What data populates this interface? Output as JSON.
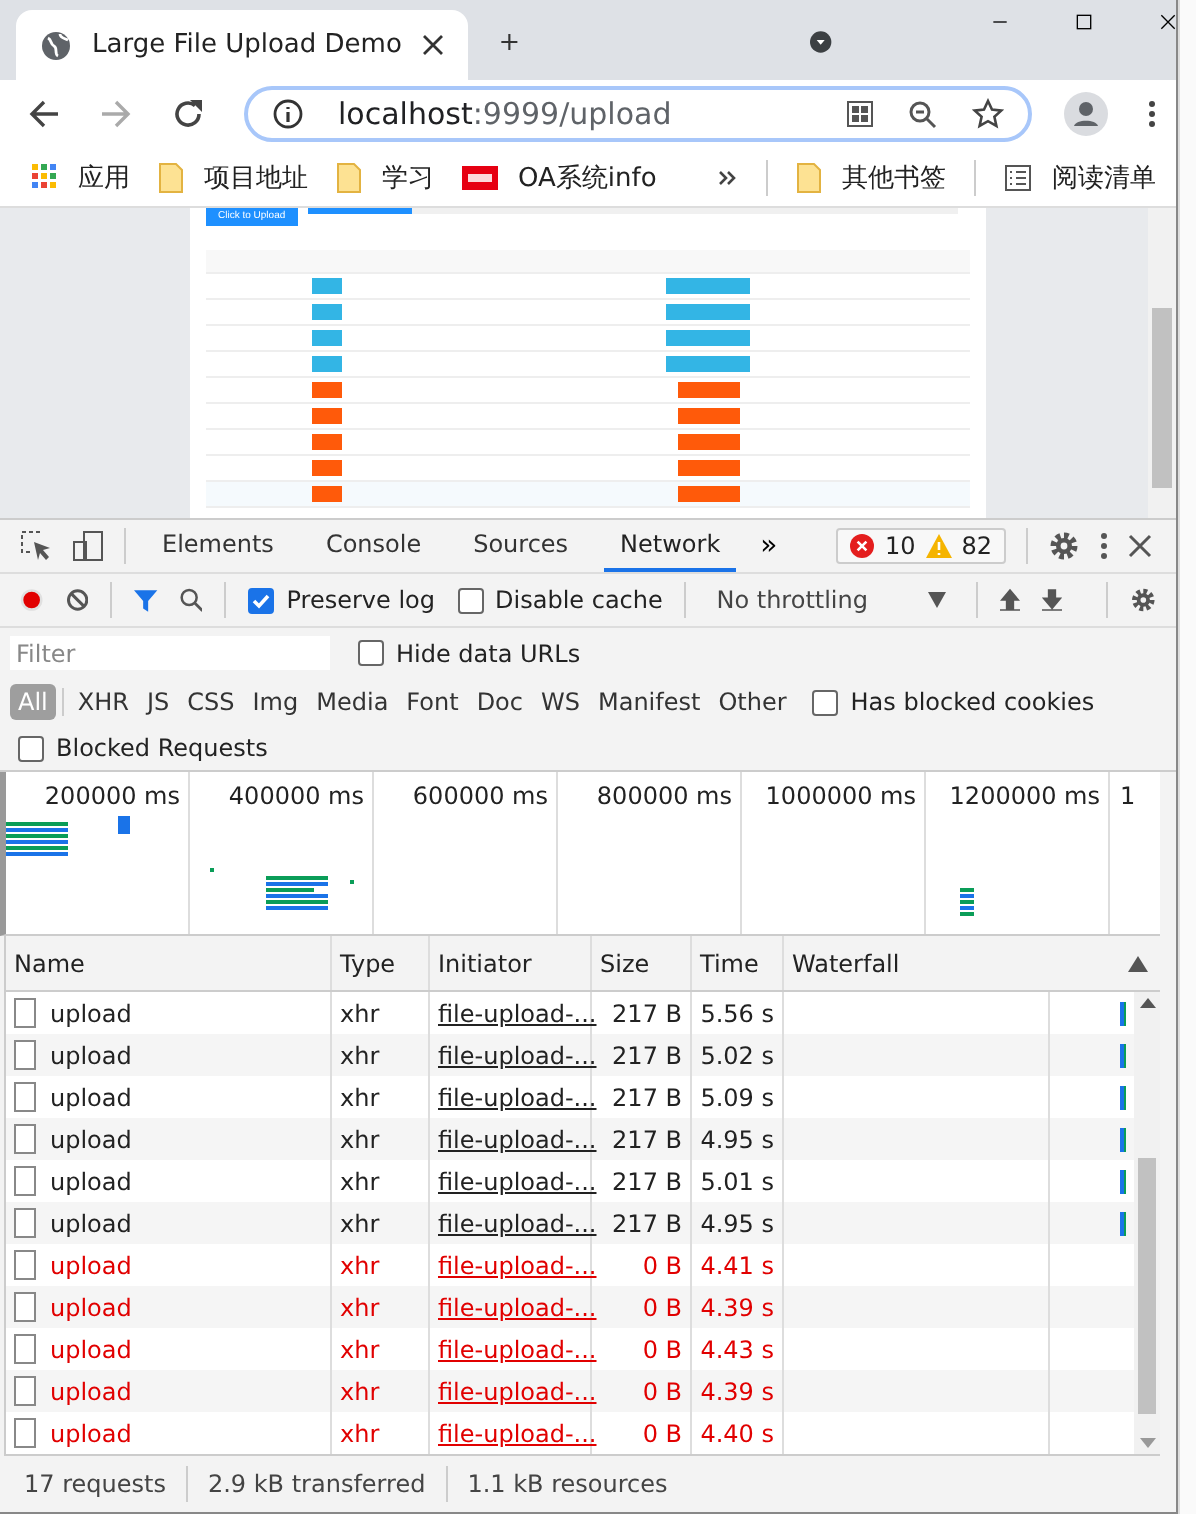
{
  "browser": {
    "tab_title": "Large File Upload Demo",
    "address": {
      "host": "localhost",
      "rest": ":9999/upload"
    },
    "bookmarks": [
      {
        "label": "应用",
        "kind": "apps"
      },
      {
        "label": "项目地址",
        "kind": "folder"
      },
      {
        "label": "学习",
        "kind": "folder"
      },
      {
        "label": "OA系统info",
        "kind": "site"
      }
    ],
    "other_bookmarks": "其他书签",
    "reading_list": "阅读清单"
  },
  "page": {
    "upload_button": "Click to Upload",
    "progress": {
      "level": 0.16
    },
    "rows": [
      {
        "kind": "info"
      },
      {
        "kind": "info"
      },
      {
        "kind": "info"
      },
      {
        "kind": "info"
      },
      {
        "kind": "error"
      },
      {
        "kind": "error"
      },
      {
        "kind": "error"
      },
      {
        "kind": "error"
      },
      {
        "kind": "error"
      }
    ]
  },
  "devtools": {
    "tabs": [
      {
        "label": "Elements",
        "selected": false
      },
      {
        "label": "Console",
        "selected": false
      },
      {
        "label": "Sources",
        "selected": false
      },
      {
        "label": "Network",
        "selected": true
      }
    ],
    "more": "»",
    "errors": "10",
    "warnings": "82",
    "preserve_log": {
      "label": "Preserve log",
      "checked": true
    },
    "disable_cache": {
      "label": "Disable cache",
      "checked": false
    },
    "throttling": "No throttling",
    "filter": {
      "placeholder": "Filter"
    },
    "hide_data_urls": {
      "label": "Hide data URLs",
      "checked": false
    },
    "types": [
      {
        "label": "All",
        "selected": true
      },
      {
        "label": "XHR",
        "selected": false
      },
      {
        "label": "JS",
        "selected": false
      },
      {
        "label": "CSS",
        "selected": false
      },
      {
        "label": "Img",
        "selected": false
      },
      {
        "label": "Media",
        "selected": false
      },
      {
        "label": "Font",
        "selected": false
      },
      {
        "label": "Doc",
        "selected": false
      },
      {
        "label": "WS",
        "selected": false
      },
      {
        "label": "Manifest",
        "selected": false
      },
      {
        "label": "Other",
        "selected": false
      }
    ],
    "blocked_cookies": {
      "label": "Has blocked cookies",
      "checked": false
    },
    "blocked_requests": {
      "label": "Blocked Requests",
      "checked": false
    },
    "ticks": [
      "200000 ms",
      "400000 ms",
      "600000 ms",
      "800000 ms",
      "1000000 ms",
      "1200000 ms",
      "1"
    ],
    "columns": [
      "Name",
      "Type",
      "Initiator",
      "Size",
      "Time",
      "Waterfall"
    ],
    "requests": [
      {
        "name": "upload",
        "type": "xhr",
        "initiator": "file-upload-...",
        "size": "217 B",
        "time": "5.56 s",
        "failed": false
      },
      {
        "name": "upload",
        "type": "xhr",
        "initiator": "file-upload-...",
        "size": "217 B",
        "time": "5.02 s",
        "failed": false
      },
      {
        "name": "upload",
        "type": "xhr",
        "initiator": "file-upload-...",
        "size": "217 B",
        "time": "5.09 s",
        "failed": false
      },
      {
        "name": "upload",
        "type": "xhr",
        "initiator": "file-upload-...",
        "size": "217 B",
        "time": "4.95 s",
        "failed": false
      },
      {
        "name": "upload",
        "type": "xhr",
        "initiator": "file-upload-...",
        "size": "217 B",
        "time": "5.01 s",
        "failed": false
      },
      {
        "name": "upload",
        "type": "xhr",
        "initiator": "file-upload-...",
        "size": "217 B",
        "time": "4.95 s",
        "failed": false
      },
      {
        "name": "upload",
        "type": "xhr",
        "initiator": "file-upload-...",
        "size": "0 B",
        "time": "4.41 s",
        "failed": true
      },
      {
        "name": "upload",
        "type": "xhr",
        "initiator": "file-upload-...",
        "size": "0 B",
        "time": "4.39 s",
        "failed": true
      },
      {
        "name": "upload",
        "type": "xhr",
        "initiator": "file-upload-...",
        "size": "0 B",
        "time": "4.43 s",
        "failed": true
      },
      {
        "name": "upload",
        "type": "xhr",
        "initiator": "file-upload-...",
        "size": "0 B",
        "time": "4.39 s",
        "failed": true
      },
      {
        "name": "upload",
        "type": "xhr",
        "initiator": "file-upload-...",
        "size": "0 B",
        "time": "4.40 s",
        "failed": true
      }
    ],
    "status": [
      "17 requests",
      "2.9 kB transferred",
      "1.1 kB resources"
    ]
  }
}
